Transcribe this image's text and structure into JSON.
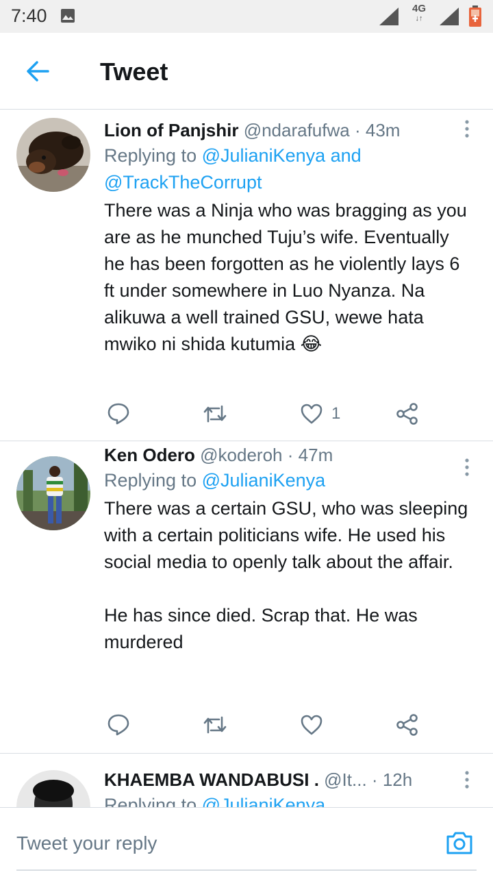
{
  "status_bar": {
    "time": "7:40",
    "network_label": "4G",
    "icons": [
      "image-icon",
      "signal-icon",
      "signal-icon",
      "battery-icon"
    ]
  },
  "header": {
    "title": "Tweet",
    "back_icon": "arrow-left-icon"
  },
  "accent_color": "#1da1f2",
  "tweets": [
    {
      "name": "Lion of Panjshir",
      "handle": "@ndarafufwa",
      "separator": "·",
      "time_ago": "43m",
      "reply_prefix": "Replying to",
      "reply_to_1": "@JulianiKenya and",
      "reply_to_2": "@TrackTheCorrupt",
      "text": "There was a Ninja who was bragging as you are as he munched Tuju’s wife. Eventually he has been forgotten as he violently lays 6 ft under somewhere in Luo Nyanza. Na alikuwa a well trained GSU, wewe hata mwiko ni shida kutumia",
      "emoji": "😂",
      "like_count": "1"
    },
    {
      "name": "Ken Odero",
      "handle": "@koderoh",
      "separator": "·",
      "time_ago": "47m",
      "reply_prefix": "Replying to",
      "reply_to_1": "@JulianiKenya",
      "text_p1": "There was a certain GSU, who was sleeping with a certain politicians wife. He used his social media to openly talk about the affair.",
      "text_p2": "He has since died. Scrap that. He was murdered",
      "like_count": ""
    },
    {
      "name": "KHAEMBA WANDABUSI .",
      "handle": "@It...",
      "separator": "·",
      "time_ago": "12h",
      "reply_prefix": "Replying to",
      "reply_to_1": "@JulianiKenya"
    }
  ],
  "reply_bar": {
    "placeholder": "Tweet your reply",
    "camera_icon": "camera-icon"
  }
}
